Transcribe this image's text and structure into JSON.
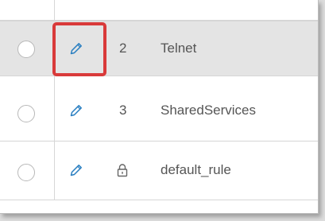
{
  "rules": [
    {
      "number": "2",
      "name": "Telnet",
      "selected_row": true,
      "locked": false
    },
    {
      "number": "3",
      "name": "SharedServices",
      "selected_row": false,
      "locked": false
    },
    {
      "number": "",
      "name": "default_rule",
      "selected_row": false,
      "locked": true
    }
  ],
  "icons": {
    "edit": "pencil-icon",
    "lock": "lock-icon"
  },
  "colors": {
    "edit_icon": "#2a7fc1",
    "highlight": "#d93a3a",
    "selected_row_bg": "#e4e4e4"
  }
}
